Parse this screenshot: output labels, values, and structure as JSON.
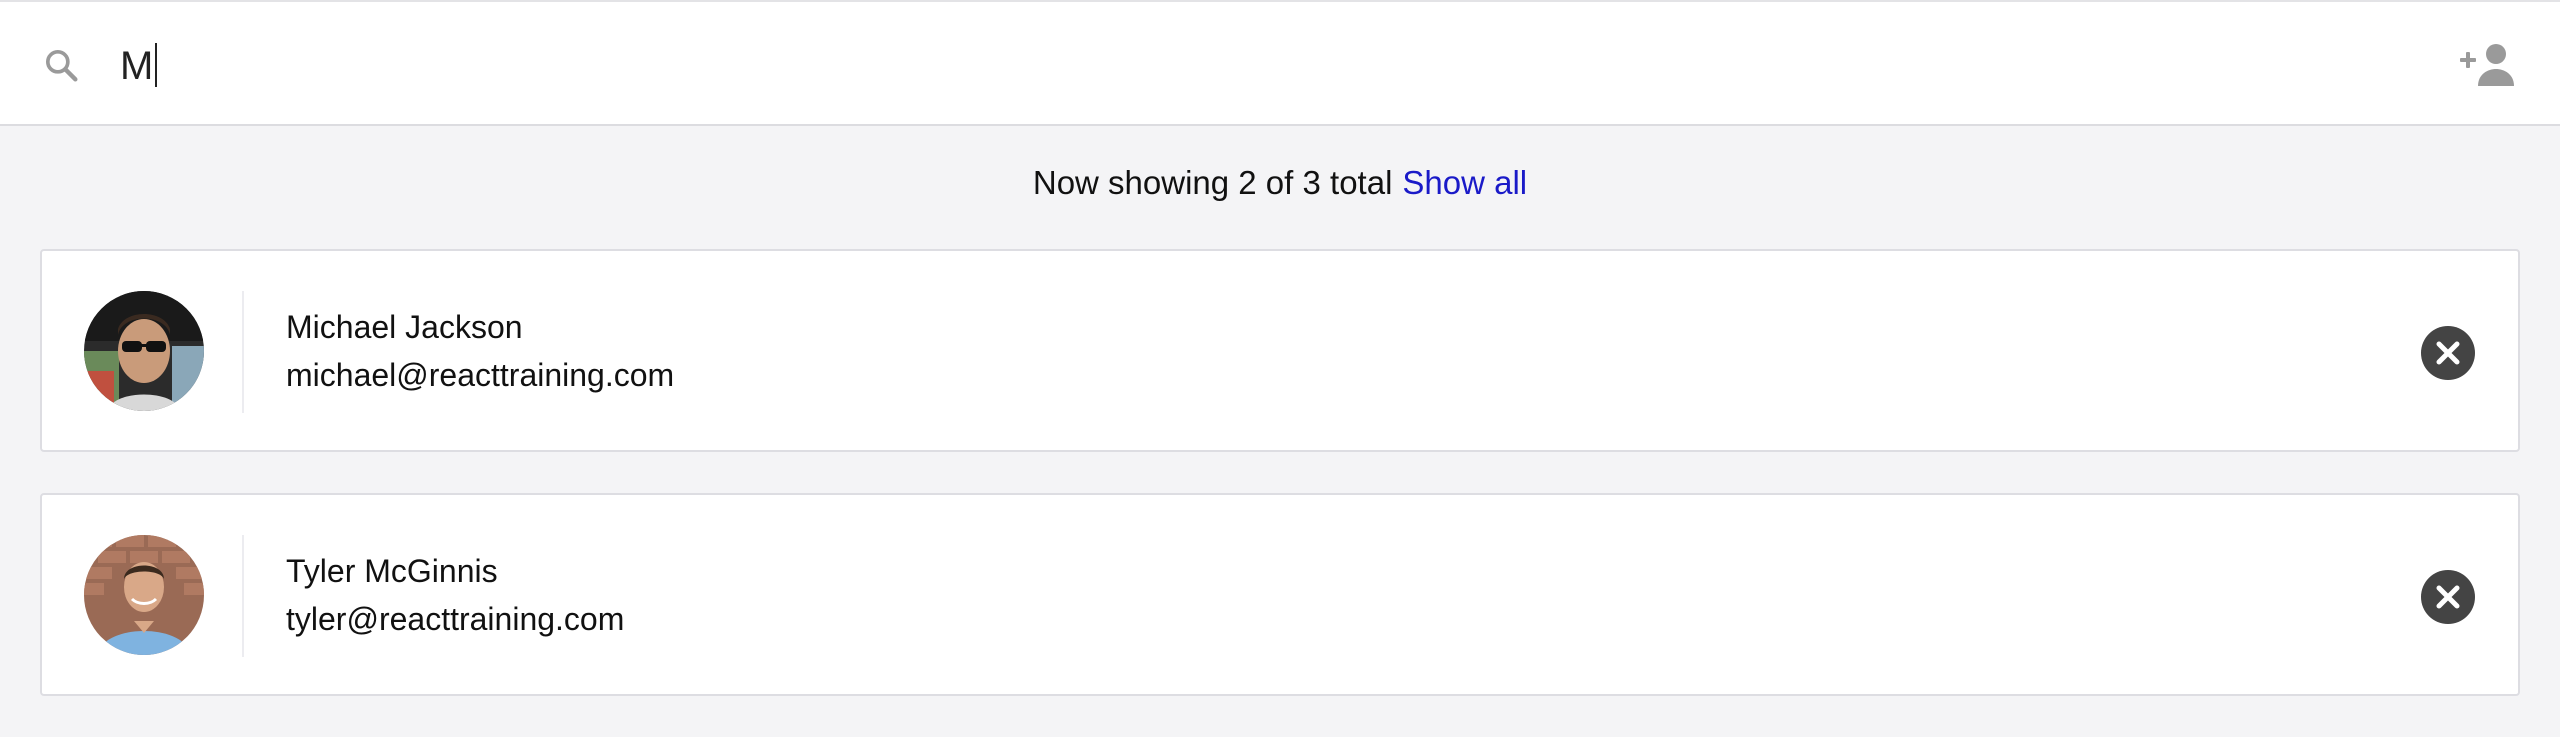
{
  "search": {
    "value": "M",
    "placeholder": ""
  },
  "status": {
    "text": "Now showing 2 of 3 total",
    "show_all_label": "Show all"
  },
  "contacts": [
    {
      "name": "Michael Jackson",
      "email": "michael@reacttraining.com"
    },
    {
      "name": "Tyler McGinnis",
      "email": "tyler@reacttraining.com"
    }
  ],
  "icons": {
    "search": "search-icon",
    "add_user": "add-user-icon",
    "remove": "close-circle-icon"
  },
  "colors": {
    "link": "#1a1ac8",
    "background": "#f4f4f6",
    "icon_gray": "#9a9a9a",
    "remove_button": "#444444"
  }
}
